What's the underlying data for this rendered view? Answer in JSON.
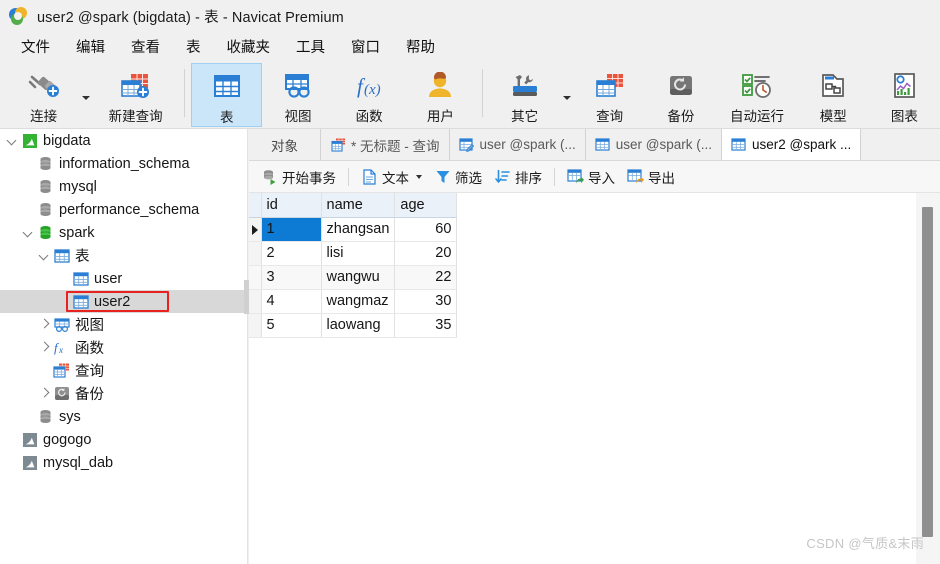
{
  "window": {
    "title": "user2 @spark (bigdata) - 表 - Navicat Premium",
    "logo_icon": "navicat-logo-icon"
  },
  "menubar": {
    "items": [
      {
        "label": "文件",
        "name": "menu-file"
      },
      {
        "label": "编辑",
        "name": "menu-edit"
      },
      {
        "label": "查看",
        "name": "menu-view"
      },
      {
        "label": "表",
        "name": "menu-table"
      },
      {
        "label": "收藏夹",
        "name": "menu-favorites"
      },
      {
        "label": "工具",
        "name": "menu-tools"
      },
      {
        "label": "窗口",
        "name": "menu-window"
      },
      {
        "label": "帮助",
        "name": "menu-help"
      }
    ]
  },
  "ribbon": {
    "buttons": [
      {
        "label": "连接",
        "icon": "connection-icon",
        "active": false,
        "caret": true
      },
      {
        "label": "新建查询",
        "icon": "new-query-icon",
        "active": false,
        "caret": false
      },
      {
        "label": "表",
        "icon": "table-icon",
        "active": true,
        "caret": false
      },
      {
        "label": "视图",
        "icon": "view-icon",
        "active": false,
        "caret": false
      },
      {
        "label": "函数",
        "icon": "function-fx-icon",
        "active": false,
        "caret": false
      },
      {
        "label": "用户",
        "icon": "user-icon",
        "active": false,
        "caret": false
      },
      {
        "label": "其它",
        "icon": "other-tools-icon",
        "active": false,
        "caret": true
      },
      {
        "label": "查询",
        "icon": "query-icon",
        "active": false,
        "caret": false
      },
      {
        "label": "备份",
        "icon": "backup-icon",
        "active": false,
        "caret": false
      },
      {
        "label": "自动运行",
        "icon": "automation-icon",
        "active": false,
        "caret": false
      },
      {
        "label": "模型",
        "icon": "model-icon",
        "active": false,
        "caret": false
      },
      {
        "label": "图表",
        "icon": "chart-icon",
        "active": false,
        "caret": false
      }
    ]
  },
  "sidebar": {
    "items": [
      {
        "label": "bigdata",
        "indent": 0,
        "twisty": "open",
        "icon": "connection-mysql-icon",
        "selected": false,
        "highlight": false
      },
      {
        "label": "information_schema",
        "indent": 1,
        "twisty": "none",
        "icon": "database-gray-icon",
        "selected": false,
        "highlight": false
      },
      {
        "label": "mysql",
        "indent": 1,
        "twisty": "none",
        "icon": "database-gray-icon",
        "selected": false,
        "highlight": false
      },
      {
        "label": "performance_schema",
        "indent": 1,
        "twisty": "none",
        "icon": "database-gray-icon",
        "selected": false,
        "highlight": false
      },
      {
        "label": "spark",
        "indent": 1,
        "twisty": "open",
        "icon": "database-green-icon",
        "selected": false,
        "highlight": false
      },
      {
        "label": "表",
        "indent": 2,
        "twisty": "open",
        "icon": "table-folder-icon",
        "selected": false,
        "highlight": false
      },
      {
        "label": "user",
        "indent": 3,
        "twisty": "none",
        "icon": "table-icon",
        "selected": false,
        "highlight": false
      },
      {
        "label": "user2",
        "indent": 3,
        "twisty": "none",
        "icon": "table-icon",
        "selected": true,
        "highlight": true
      },
      {
        "label": "视图",
        "indent": 2,
        "twisty": "closed",
        "icon": "view-folder-icon",
        "selected": false,
        "highlight": false
      },
      {
        "label": "函数",
        "indent": 2,
        "twisty": "closed",
        "icon": "function-fx-icon",
        "selected": false,
        "highlight": false
      },
      {
        "label": "查询",
        "indent": 2,
        "twisty": "none",
        "icon": "query-folder-icon",
        "selected": false,
        "highlight": false
      },
      {
        "label": "备份",
        "indent": 2,
        "twisty": "closed",
        "icon": "backup-folder-icon",
        "selected": false,
        "highlight": false
      },
      {
        "label": "sys",
        "indent": 1,
        "twisty": "none",
        "icon": "database-gray-icon",
        "selected": false,
        "highlight": false
      },
      {
        "label": "gogogo",
        "indent": 0,
        "twisty": "none",
        "icon": "connection-mysql-icon",
        "selected": false,
        "highlight": false
      },
      {
        "label": "mysql_dab",
        "indent": 0,
        "twisty": "none",
        "icon": "connection-mysql-icon",
        "selected": false,
        "highlight": false
      }
    ]
  },
  "tabs": [
    {
      "label": "对象",
      "icon": "none",
      "active": false,
      "kind": "objects"
    },
    {
      "label": "* 无标题 - 查询",
      "icon": "query-icon",
      "active": false,
      "kind": "tab"
    },
    {
      "label": "user @spark (...",
      "icon": "table-edit-icon",
      "active": false,
      "kind": "tab"
    },
    {
      "label": "user @spark (...",
      "icon": "table-icon",
      "active": false,
      "kind": "tab"
    },
    {
      "label": "user2 @spark ...",
      "icon": "table-icon",
      "active": true,
      "kind": "tab"
    }
  ],
  "data_toolbar": [
    {
      "label": "开始事务",
      "icon": "begin-transaction-icon",
      "caret": false,
      "sep_after": true
    },
    {
      "label": "文本",
      "icon": "text-document-icon",
      "caret": true,
      "sep_after": false
    },
    {
      "label": "筛选",
      "icon": "filter-funnel-icon",
      "caret": false,
      "sep_after": false
    },
    {
      "label": "排序",
      "icon": "sort-icon",
      "caret": false,
      "sep_after": true
    },
    {
      "label": "导入",
      "icon": "import-icon",
      "caret": false,
      "sep_after": false
    },
    {
      "label": "导出",
      "icon": "export-icon",
      "caret": false,
      "sep_after": false
    }
  ],
  "grid": {
    "columns": [
      "id",
      "name",
      "age"
    ],
    "rows": [
      {
        "id": "1",
        "name": "zhangsan",
        "age": "60"
      },
      {
        "id": "2",
        "name": "lisi",
        "age": "20"
      },
      {
        "id": "3",
        "name": "wangwu",
        "age": "22"
      },
      {
        "id": "4",
        "name": "wangmaz",
        "age": "30"
      },
      {
        "id": "5",
        "name": "laowang",
        "age": "35"
      }
    ],
    "active_row_index": 0,
    "active_cell_column": "id"
  },
  "watermark": "CSDN @气质&末雨",
  "colors": {
    "accent_blue": "#0d7bd4",
    "ribbon_active": "#cce6f9",
    "chrome": "#f0f0f0",
    "header": "#eaf1f8",
    "annotation_red": "#e8221f",
    "selection_gray": "#d8d8d8"
  }
}
